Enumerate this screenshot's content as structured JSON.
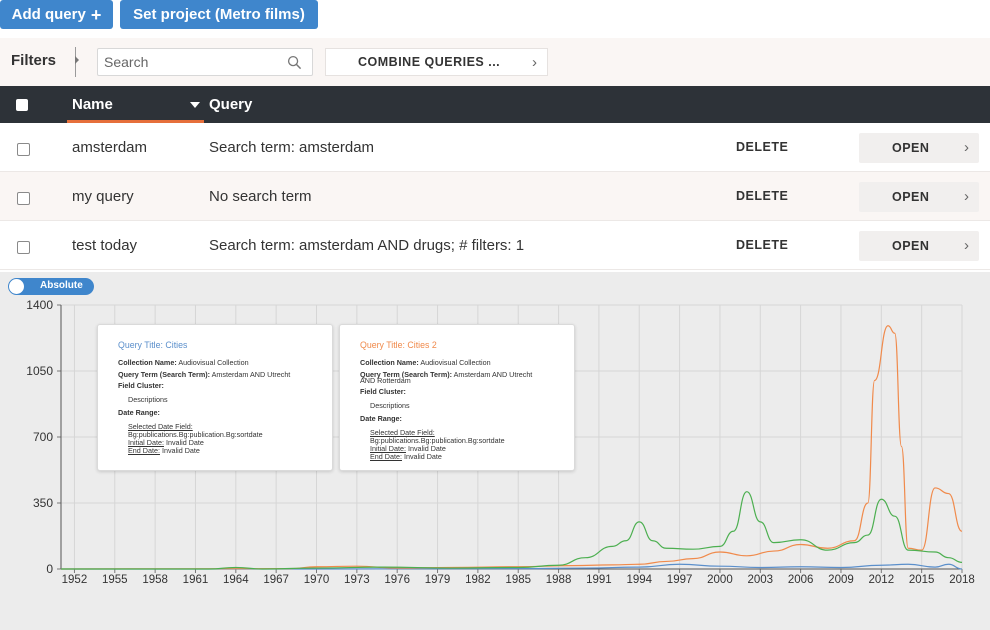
{
  "toolbar": {
    "add_query_label": "Add query",
    "add_query_icon": "plus-icon",
    "set_project_label": "Set project (Metro films)"
  },
  "filters": {
    "label": "Filters",
    "search_placeholder": "Search",
    "combine_label": "COMBINE QUERIES ..."
  },
  "table": {
    "headers": {
      "name": "Name",
      "query": "Query"
    },
    "rows": [
      {
        "name": "amsterdam",
        "query": "Search term: amsterdam",
        "delete": "DELETE",
        "open": "OPEN"
      },
      {
        "name": "my query",
        "query": "No search term",
        "delete": "DELETE",
        "open": "OPEN"
      },
      {
        "name": "test today",
        "query": "Search term: amsterdam AND drugs; # filters: 1",
        "delete": "DELETE",
        "open": "OPEN"
      }
    ]
  },
  "toggle": {
    "label": "Absolute"
  },
  "colors": {
    "blue": "#5b8fcb",
    "orange": "#f08a4b",
    "green": "#4caf50",
    "button": "#3f86cc",
    "header": "#2d3238",
    "accent": "#e66f3b"
  },
  "chart_data": {
    "type": "line",
    "ylim": [
      0,
      1400
    ],
    "y_ticks": [
      0,
      350,
      700,
      1050,
      1400
    ],
    "y_tick_labels": [
      "0",
      "350",
      "700",
      "1050",
      "1400"
    ],
    "xlim": [
      1951,
      2018
    ],
    "x_tick_labels": [
      "1952",
      "1955",
      "1958",
      "1961",
      "1964",
      "1967",
      "1970",
      "1973",
      "1976",
      "1979",
      "1982",
      "1985",
      "1988",
      "1991",
      "1994",
      "1997",
      "2000",
      "2003",
      "2006",
      "2009",
      "2012",
      "2015",
      "2018"
    ],
    "grid": true,
    "series": [
      {
        "color": "#5b8fcb",
        "points": [
          [
            1951,
            0
          ],
          [
            1970,
            0
          ],
          [
            1985,
            2
          ],
          [
            1990,
            5
          ],
          [
            1994,
            10
          ],
          [
            1997,
            25
          ],
          [
            2000,
            15
          ],
          [
            2003,
            8
          ],
          [
            2006,
            12
          ],
          [
            2009,
            8
          ],
          [
            2012,
            20
          ],
          [
            2014,
            25
          ],
          [
            2016,
            10
          ],
          [
            2017,
            25
          ],
          [
            2018,
            0
          ]
        ]
      },
      {
        "color": "#f08a4b",
        "points": [
          [
            1951,
            0
          ],
          [
            1968,
            2
          ],
          [
            1970,
            12
          ],
          [
            1973,
            15
          ],
          [
            1976,
            5
          ],
          [
            1980,
            8
          ],
          [
            1985,
            12
          ],
          [
            1989,
            18
          ],
          [
            1992,
            22
          ],
          [
            1994,
            25
          ],
          [
            1996,
            40
          ],
          [
            1998,
            55
          ],
          [
            2000,
            90
          ],
          [
            2002,
            70
          ],
          [
            2004,
            95
          ],
          [
            2006,
            130
          ],
          [
            2008,
            110
          ],
          [
            2010,
            150
          ],
          [
            2011,
            350
          ],
          [
            2011.5,
            1000
          ],
          [
            2012.5,
            1290
          ],
          [
            2013,
            1250
          ],
          [
            2013.5,
            650
          ],
          [
            2014,
            110
          ],
          [
            2015,
            100
          ],
          [
            2016,
            430
          ],
          [
            2017,
            400
          ],
          [
            2018,
            200
          ]
        ]
      },
      {
        "color": "#4caf50",
        "points": [
          [
            1951,
            0
          ],
          [
            1962,
            0
          ],
          [
            1964,
            8
          ],
          [
            1966,
            0
          ],
          [
            1970,
            5
          ],
          [
            1975,
            10
          ],
          [
            1980,
            5
          ],
          [
            1985,
            8
          ],
          [
            1988,
            20
          ],
          [
            1990,
            60
          ],
          [
            1992,
            120
          ],
          [
            1993,
            150
          ],
          [
            1994,
            250
          ],
          [
            1995,
            150
          ],
          [
            1996,
            110
          ],
          [
            1998,
            105
          ],
          [
            2000,
            120
          ],
          [
            2001,
            200
          ],
          [
            2002,
            410
          ],
          [
            2003,
            250
          ],
          [
            2004,
            140
          ],
          [
            2006,
            155
          ],
          [
            2008,
            100
          ],
          [
            2010,
            140
          ],
          [
            2011,
            180
          ],
          [
            2012,
            370
          ],
          [
            2013,
            280
          ],
          [
            2014,
            100
          ],
          [
            2016,
            90
          ],
          [
            2017,
            60
          ],
          [
            2018,
            35
          ]
        ]
      }
    ],
    "tooltips": [
      {
        "title": "Query Title: Cities",
        "title_color": "#5b8fcb",
        "collection_label": "Collection Name:",
        "collection_value": "Audiovisual Collection",
        "term_label": "Query Term (Search Term):",
        "term_value": "Amsterdam AND Utrecht",
        "field_cluster_label": "Field Cluster:",
        "field_cluster_value": "Descriptions",
        "date_range_label": "Date Range:",
        "selected_date_label": "Selected Date Field:",
        "selected_date_value": "Bg:publications.Bg:publication.Bg:sortdate",
        "initial_date_label": "Initial Date:",
        "initial_date_value": "Invalid Date",
        "end_date_label": "End Date:",
        "end_date_value": "Invalid Date"
      },
      {
        "title": "Query Title: Cities 2",
        "title_color": "#f08a4b",
        "collection_label": "Collection Name:",
        "collection_value": "Audiovisual Collection",
        "term_label": "Query Term (Search Term):",
        "term_value": "Amsterdam AND Utrecht",
        "term_value_line2": "AND Rotterdam",
        "field_cluster_label": "Field Cluster:",
        "field_cluster_value": "Descriptions",
        "date_range_label": "Date Range:",
        "selected_date_label": "Selected Date Field:",
        "selected_date_value": "Bg:publications.Bg:publication.Bg:sortdate",
        "initial_date_label": "Initial Date:",
        "initial_date_value": "Invalid Date",
        "end_date_label": "End Date:",
        "end_date_value": "Invalid Date"
      }
    ]
  }
}
